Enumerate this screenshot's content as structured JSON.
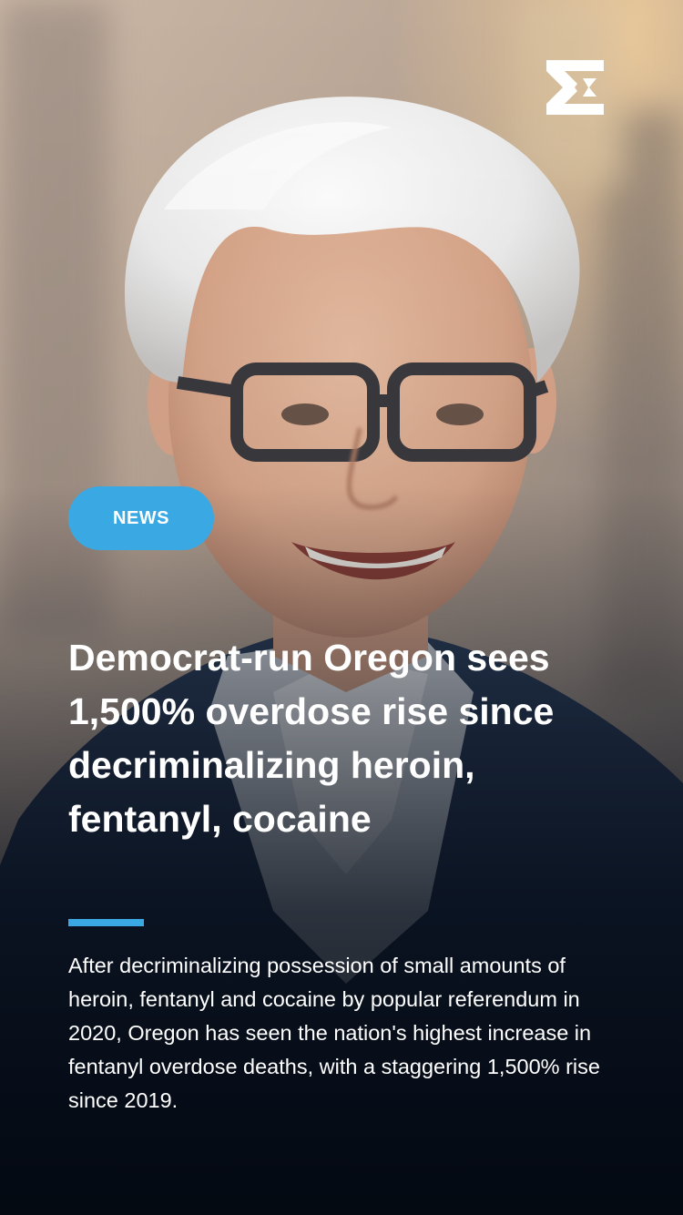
{
  "badge": {
    "label": "NEWS"
  },
  "article": {
    "headline": "Democrat-run Oregon sees 1,500% overdose rise since decriminalizing heroin, fentanyl, cocaine",
    "summary": "After decriminalizing possession of small amounts of heroin, fentanyl and cocaine by popular referendum in 2020, Oregon has seen the nation's highest increase in fentanyl overdose deaths, with a staggering 1,500% rise since 2019."
  },
  "colors": {
    "accent": "#3aa8e3",
    "text": "#ffffff",
    "background": "#0b1320"
  },
  "icons": {
    "brand": "brand-logo-icon"
  }
}
